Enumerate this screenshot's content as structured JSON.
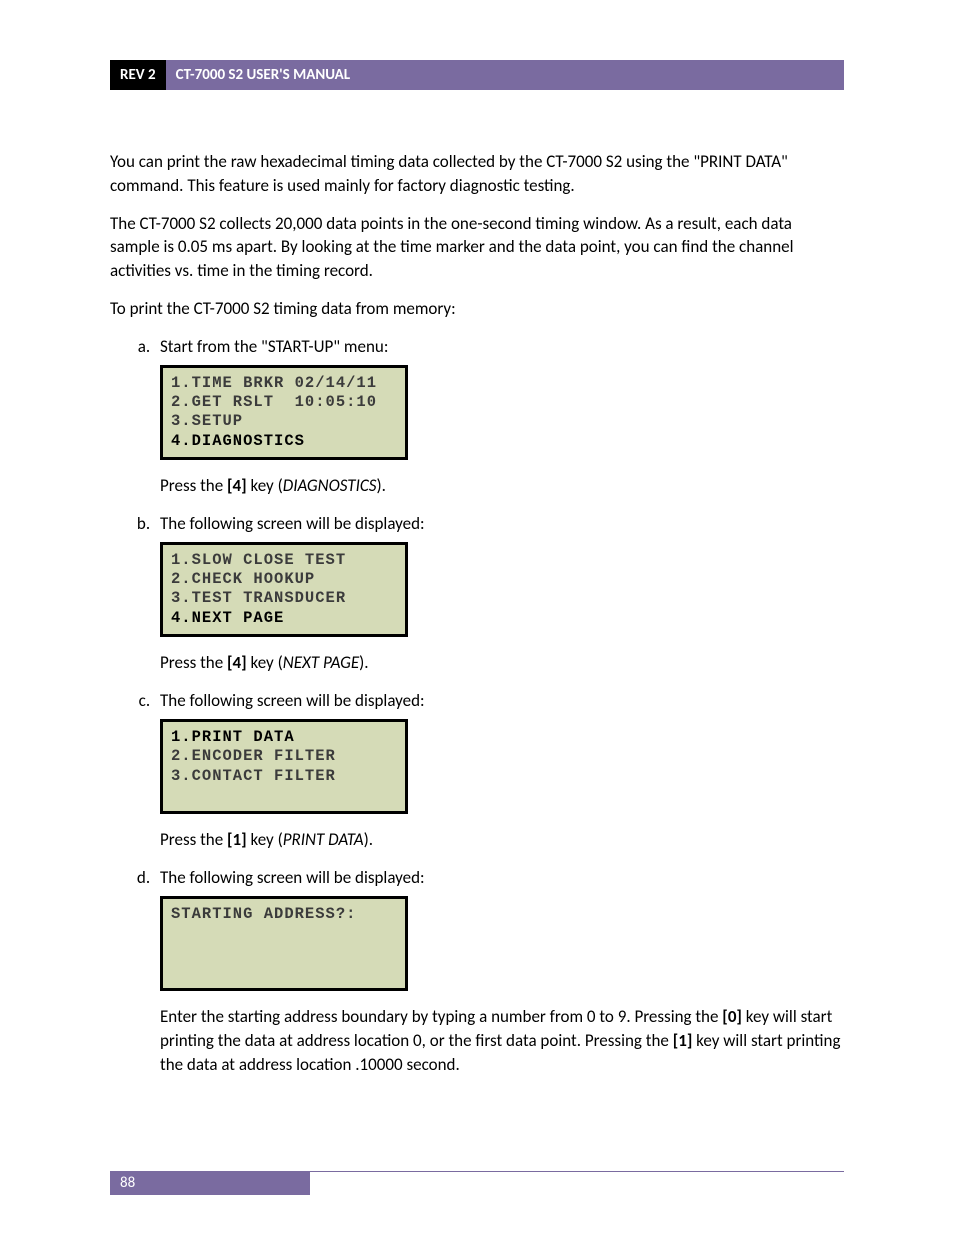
{
  "header": {
    "rev": "REV 2",
    "title": "CT-7000 S2 USER'S MANUAL"
  },
  "paragraphs": {
    "intro1": "You can print the raw hexadecimal timing data collected by the CT-7000 S2 using the \"PRINT DATA\" command. This feature is used mainly for factory diagnostic testing.",
    "intro2": "The CT-7000 S2 collects 20,000 data points in the one-second timing window. As a result, each data sample is 0.05 ms apart. By looking at the time marker and the data point, you can find the channel activities vs. time in the timing record.",
    "intro3": "To print the CT-7000 S2 timing data from memory:"
  },
  "steps": {
    "a": {
      "text": "Start from the \"START-UP\" menu:",
      "screen": {
        "l1": "1.TIME BRKR 02/14/11",
        "l2": "2.GET RSLT  10:05:10",
        "l3": "3.SETUP",
        "l4": "4.DIAGNOSTICS"
      },
      "press_pre": "Press the ",
      "press_key": "[4]",
      "press_mid": " key (",
      "press_ital": "DIAGNOSTICS",
      "press_post": ")."
    },
    "b": {
      "text": "The following screen will be displayed:",
      "screen": {
        "l1": "1.SLOW CLOSE TEST",
        "l2": "2.CHECK HOOKUP",
        "l3": "3.TEST TRANSDUCER",
        "l4": "4.NEXT PAGE"
      },
      "press_pre": "Press the ",
      "press_key": "[4]",
      "press_mid": " key (",
      "press_ital": "NEXT PAGE",
      "press_post": ")."
    },
    "c": {
      "text": "The following screen will be displayed:",
      "screen": {
        "l1": "1.PRINT DATA",
        "l2": "2.ENCODER FILTER",
        "l3": "3.CONTACT FILTER",
        "l4": " "
      },
      "press_pre": "Press the ",
      "press_key": "[1]",
      "press_mid": " key (",
      "press_ital": "PRINT DATA",
      "press_post": ")."
    },
    "d": {
      "text": "The following screen will be displayed:",
      "screen": {
        "l1": "STARTING ADDRESS?:",
        "l2": " ",
        "l3": " ",
        "l4": " "
      },
      "tail_p1a": "Enter the starting address boundary by typing a number from 0 to 9. Pressing the ",
      "tail_k1": "[0]",
      "tail_p1b": " key will start printing the data at address location 0, or the first data point. Pressing the ",
      "tail_k2": "[1]",
      "tail_p1c": " key will start printing the data at address location .10000 second."
    }
  },
  "footer": {
    "page_number": "88"
  }
}
